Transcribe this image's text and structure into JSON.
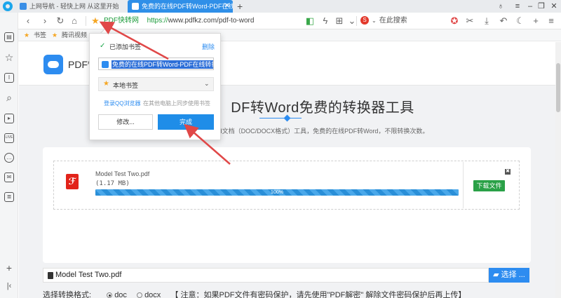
{
  "tabs": [
    {
      "label": "上网导航 - 轻快上网 从这里开始",
      "active": false
    },
    {
      "label": "免费的在线PDF转Word-PDF在线转",
      "active": true
    }
  ],
  "toolbar": {
    "bookmark_site": "PDF快转网",
    "url_scheme": "https://",
    "url_host": "www.pdfkz.com",
    "url_path": "/pdf-to-word",
    "search_placeholder": "在此搜索"
  },
  "bookmarks_bar": {
    "items": [
      "书签",
      "腾讯视频"
    ]
  },
  "sidebar": {
    "items": [
      "home-icon",
      "favorites-icon",
      "reader-icon",
      "search-icon",
      "video-icon",
      "live-icon",
      "chat-icon",
      "mail-icon",
      "notes-icon"
    ]
  },
  "site": {
    "brand": "PDF快",
    "title": "DF转Word免费的转换器工具",
    "subtitle": "rd文档（DOC/DOCX格式）工具，免费的在线PDF转Word，不限转换次数。",
    "accent": "#2d8cf0"
  },
  "file": {
    "name": "Model Test Two.pdf",
    "size": "(1.17 MB)",
    "progress": 100,
    "progress_label": "100%",
    "download_label": "下载文件",
    "close_glyph": "✖"
  },
  "chooser": {
    "value": "Model Test Two.pdf",
    "button_label": "选择 ..."
  },
  "format": {
    "label": "选择转换格式:",
    "options": [
      "doc",
      "docx"
    ],
    "selected": "doc",
    "note": "【 注意：如果PDF文件有密码保护，请先使用\"PDF解密\" 解除文件密码保护后再上传】"
  },
  "popup": {
    "added_label": "已添加书签",
    "delete_label": "删除",
    "bookmark_name": "免费的在线PDF转Word-PDF在线转换",
    "folder_label": "本地书签",
    "qq_login": "登录QQ浏览器",
    "qq_desc": "在其他电脑上同步使用书签",
    "edit_label": "修改...",
    "done_label": "完成"
  },
  "colors": {
    "annotation_arrow": "#e04848",
    "progress": "#2a8fd8",
    "download": "#2aa147"
  }
}
